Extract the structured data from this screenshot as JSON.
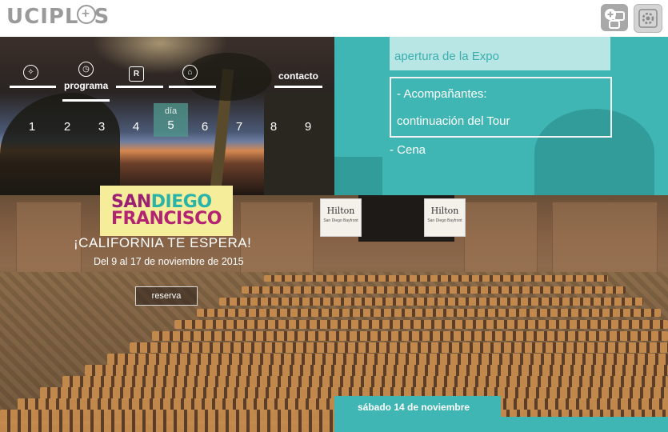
{
  "brand": {
    "logo_text_left": "UCIPL",
    "logo_text_right": "S",
    "logo_plus": "+"
  },
  "toolbar": {
    "chat_icon": "chat-add-icon",
    "settings_icon": "gear-icon"
  },
  "nav": {
    "items": [
      {
        "icon": "compass-icon",
        "label": ""
      },
      {
        "icon": "clock-icon",
        "label": "programa"
      },
      {
        "icon": "r-icon",
        "label": ""
      },
      {
        "icon": "house-icon",
        "label": ""
      },
      {
        "icon": "",
        "label": "contacto"
      }
    ],
    "day_label": "día",
    "days": [
      "1",
      "2",
      "3",
      "4",
      "5",
      "6",
      "7",
      "8",
      "9"
    ],
    "active_day": "5"
  },
  "schedule": {
    "item1": "apertura de la Expo",
    "item2_line1": "- Acompañantes:",
    "item2_line2": "continuación del Tour",
    "item3": "- Cena"
  },
  "promo": {
    "logo_line1_a": "SAN",
    "logo_line1_b": "DIEGO",
    "logo_line2": "FRANCISCO",
    "tagline": "¡CALIFORNIA TE ESPERA!",
    "dates": "Del 9 al 17 de noviembre de 2015",
    "button": "reserva"
  },
  "venue": {
    "banner_title": "Hilton",
    "banner_sub": "San Diego Bayfront"
  },
  "date_bar": {
    "text": "sábado 14 de noviembre"
  },
  "colors": {
    "teal": "#3fb6b3",
    "logo_magenta": "#9b1f72",
    "logo_yellow": "#f6ed9a"
  }
}
